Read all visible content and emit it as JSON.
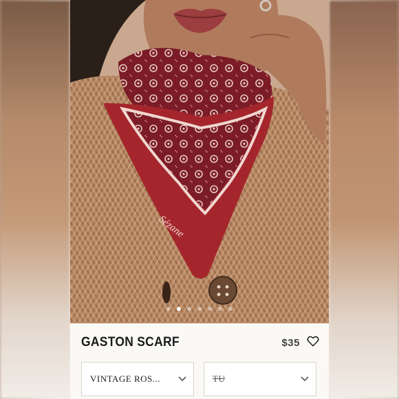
{
  "product": {
    "name": "GASTON SCARF",
    "price": "$35"
  },
  "gallery": {
    "image_count": 7,
    "active_index": 1
  },
  "selectors": {
    "color": {
      "value": "VINTAGE ROS..."
    },
    "size": {
      "value": "TU",
      "unavailable": true
    }
  },
  "icons": {
    "wishlist": "heart-icon",
    "dropdown": "chevron-down-icon"
  },
  "colors": {
    "scarf_red": "#a4262c",
    "sweater_tan": "#b5845e",
    "title_text": "#1a1a1a"
  },
  "photo_labels": {
    "scarf_signature": "Sézane"
  }
}
